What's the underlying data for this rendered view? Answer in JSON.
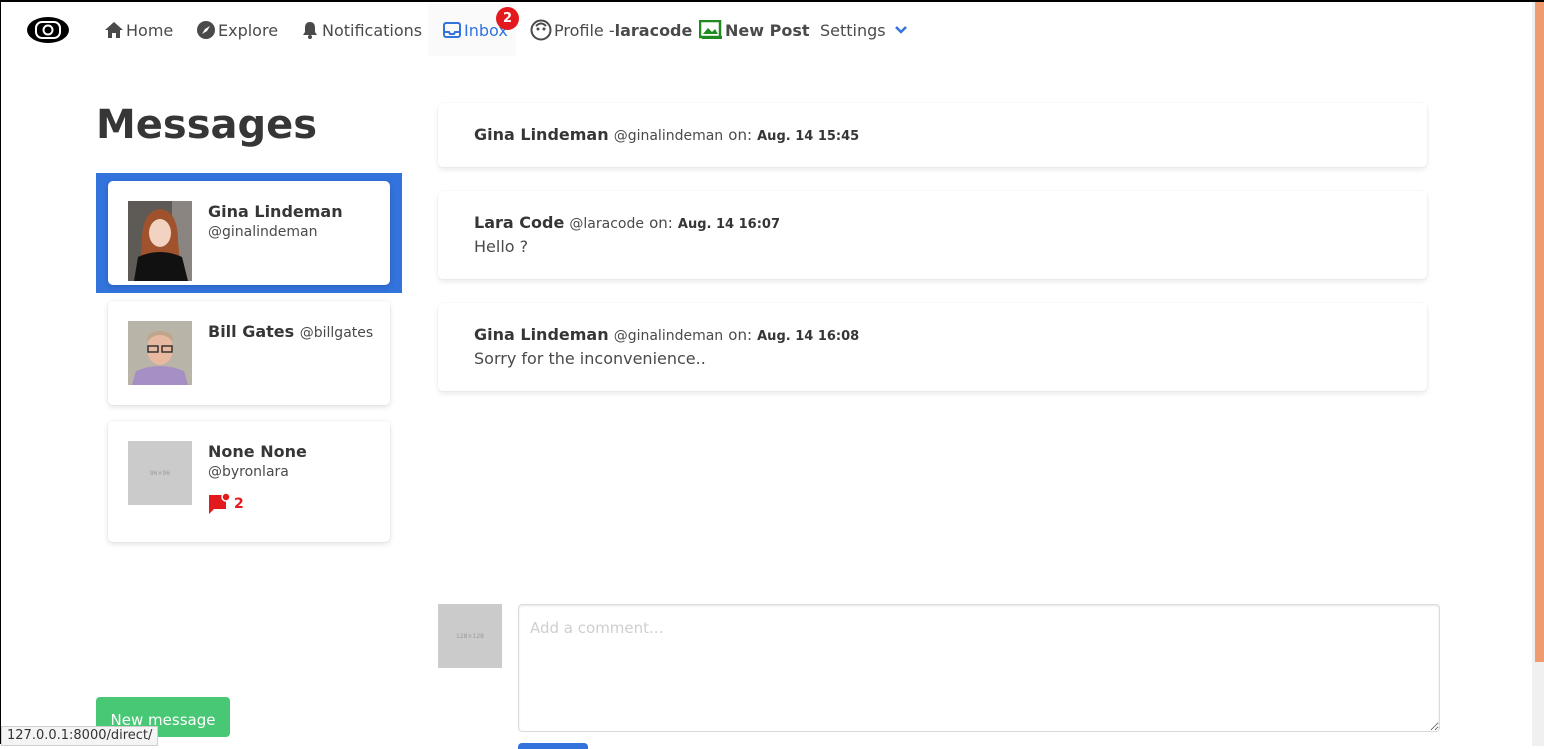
{
  "nav": {
    "home": "Home",
    "explore": "Explore",
    "notifications": "Notifications",
    "inbox": "Inbox",
    "inbox_badge": "2",
    "profile_prefix": "Profile -",
    "profile_user": "laracode",
    "new_post": "New Post",
    "settings": "Settings"
  },
  "page_title": "Messages",
  "conversations": [
    {
      "name": "Gina Lindeman",
      "handle": "@ginalindeman",
      "selected": true
    },
    {
      "name": "Bill Gates",
      "handle": "@billgates"
    },
    {
      "name": "None None",
      "handle": "@byronlara",
      "avatar_placeholder": "96×96",
      "unread": "2"
    }
  ],
  "messages": [
    {
      "author": "Gina Lindeman",
      "handle": "@ginalindeman",
      "on": "on:",
      "date": "Aug. 14 15:45",
      "body": ""
    },
    {
      "author": "Lara Code",
      "handle": "@laracode",
      "on": "on:",
      "date": "Aug. 14 16:07",
      "body": "Hello ?"
    },
    {
      "author": "Gina Lindeman",
      "handle": "@ginalindeman",
      "on": "on:",
      "date": "Aug. 14 16:08",
      "body": "Sorry for the inconvenience.."
    }
  ],
  "composer": {
    "avatar_placeholder": "128×128",
    "placeholder": "Add a comment..."
  },
  "new_message_label": "New message",
  "status_url": "127.0.0.1:8000/direct/",
  "colors": {
    "accent": "#3273dc",
    "success": "#48c774",
    "danger": "#e4191d"
  }
}
